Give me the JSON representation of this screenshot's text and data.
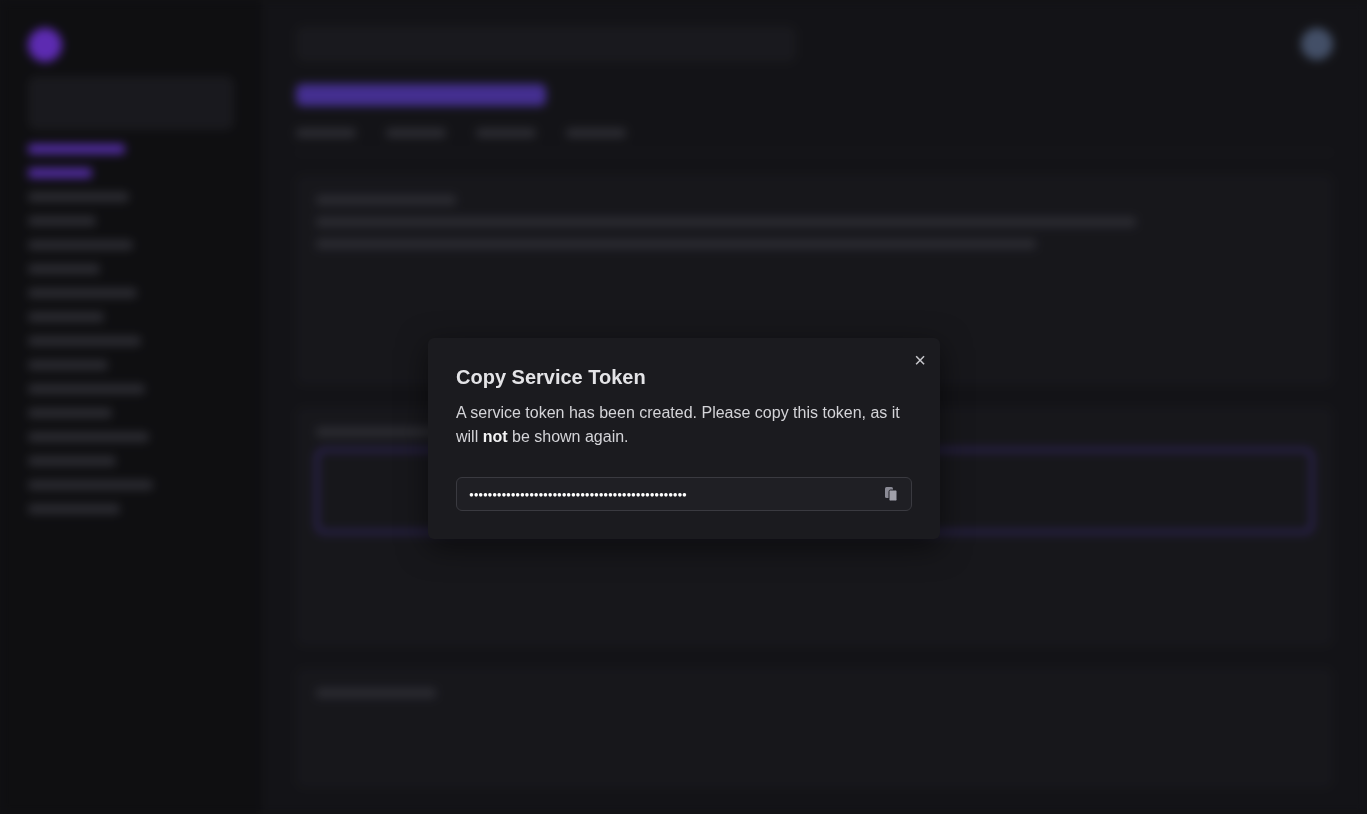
{
  "dialog": {
    "title": "Copy Service Token",
    "message": "A service token has been created. Please copy this token, as it will **not** be shown again.",
    "close_label": "×",
    "token_field": {
      "masked_value": "●●●●●●●●●●●●●●●●●●●●●●●●●●●●●●●●●●●●●●●●●●●●●●●"
    }
  }
}
